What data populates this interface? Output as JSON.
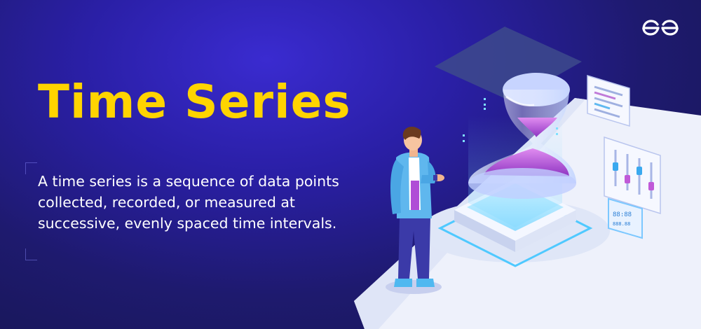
{
  "banner": {
    "title": "Time Series",
    "description": "A time series is a sequence of data points collected, recorded, or measured at successive, evenly spaced time intervals."
  },
  "logo": {
    "brand": "GeeksforGeeks",
    "icon": "gfg-logo-icon"
  },
  "illustration": {
    "icons": [
      "hourglass-icon",
      "person-figure",
      "data-bars-panel-icon",
      "slider-panel-icon",
      "digital-clock-panel-icon"
    ]
  },
  "colors": {
    "background_top": "#3a2bd0",
    "background_bottom": "#16154f",
    "title": "#ffd400",
    "text": "#ffffff",
    "platform": "#e9edfb",
    "accent_cyan": "#5fd3ff",
    "hourglass_sand": "#b04dd6"
  }
}
